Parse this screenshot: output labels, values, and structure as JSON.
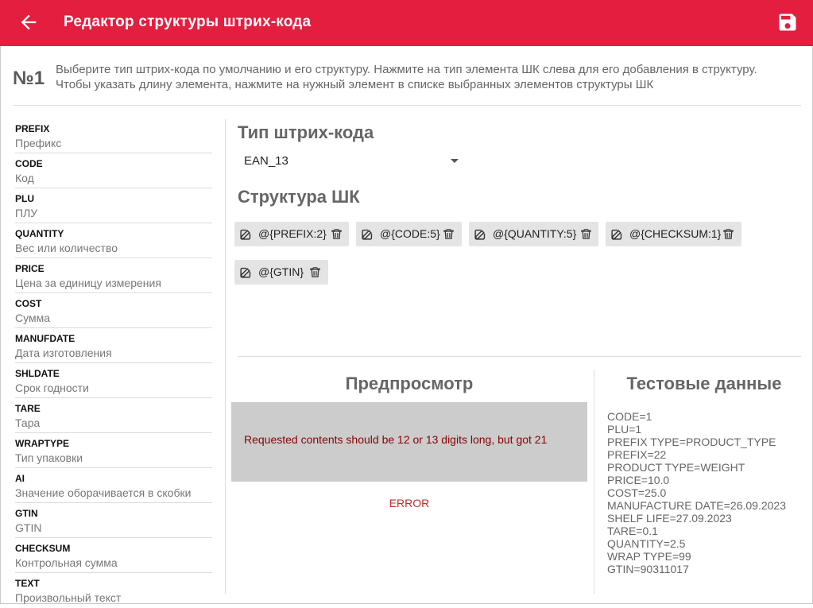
{
  "appbar": {
    "title": "Редактор структуры штрих-кода",
    "back_icon": "arrow-left-icon",
    "save_icon": "floppy-disk-icon",
    "color": "#e31e3f"
  },
  "step": {
    "number": "№1",
    "instruction": "Выберите тип штрих-кода по умолчанию и его структуру. Нажмите на тип элемента ШК слева для его добавления в структуру. Чтобы указать длину элемента, нажмите на нужный элемент в списке выбранных элементов структуры ШК"
  },
  "elements": [
    {
      "code": "PREFIX",
      "desc": "Префикс"
    },
    {
      "code": "CODE",
      "desc": "Код"
    },
    {
      "code": "PLU",
      "desc": "ПЛУ"
    },
    {
      "code": "QUANTITY",
      "desc": "Вес или количество"
    },
    {
      "code": "PRICE",
      "desc": "Цена за единицу измерения"
    },
    {
      "code": "COST",
      "desc": "Сумма"
    },
    {
      "code": "MANUFDATE",
      "desc": "Дата изготовления"
    },
    {
      "code": "SHLDATE",
      "desc": "Срок годности"
    },
    {
      "code": "TARE",
      "desc": "Тара"
    },
    {
      "code": "WRAPTYPE",
      "desc": "Тип упаковки"
    },
    {
      "code": "AI",
      "desc": "Значение оборачивается в скобки"
    },
    {
      "code": "GTIN",
      "desc": "GTIN"
    },
    {
      "code": "CHECKSUM",
      "desc": "Контрольная сумма"
    },
    {
      "code": "TEXT",
      "desc": "Произвольный текст"
    }
  ],
  "barcode_type": {
    "heading": "Тип штрих-кода",
    "selected": "EAN_13"
  },
  "structure": {
    "heading": "Структура ШК",
    "chips": [
      "@{PREFIX:2}",
      "@{CODE:5}",
      "@{QUANTITY:5}",
      "@{CHECKSUM:1}",
      "@{GTIN}"
    ]
  },
  "preview": {
    "heading": "Предпросмотр",
    "message": "Requested contents should be 12 or 13 digits long, but got 21",
    "status": "ERROR"
  },
  "test_data": {
    "heading": "Тестовые данные",
    "lines": [
      "CODE=1",
      "PLU=1",
      "PREFIX TYPE=PRODUCT_TYPE",
      "PREFIX=22",
      "PRODUCT TYPE=WEIGHT",
      "PRICE=10.0",
      "COST=25.0",
      "MANUFACTURE DATE=26.09.2023",
      "SHELF LIFE=27.09.2023",
      "TARE=0.1",
      "QUANTITY=2.5",
      "WRAP TYPE=99",
      "GTIN=90311017"
    ]
  }
}
